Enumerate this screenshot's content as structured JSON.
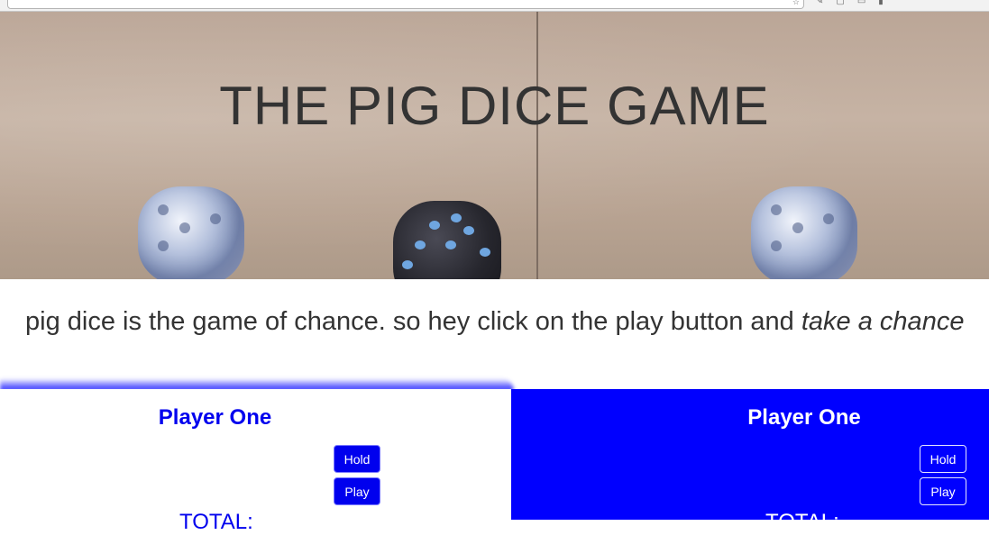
{
  "hero": {
    "title": "THE PIG DICE GAME"
  },
  "intro": {
    "text": "pig dice is the game of chance. so hey click on the play button and ",
    "emphasis": "take a chance"
  },
  "players": [
    {
      "name": "Player One",
      "hold_label": "Hold",
      "play_label": "Play",
      "total_label": "TOTAL:"
    },
    {
      "name": "Player One",
      "hold_label": "Hold",
      "play_label": "Play",
      "total_label": "TOTAL:"
    }
  ],
  "colors": {
    "accent_blue": "#0000ff",
    "text_dark": "#333333",
    "panel_left_bg": "#ffffff"
  },
  "icons": [
    "star-icon",
    "extension-icon",
    "bookmark-icon",
    "pen-icon",
    "window-icon",
    "trash-icon"
  ]
}
